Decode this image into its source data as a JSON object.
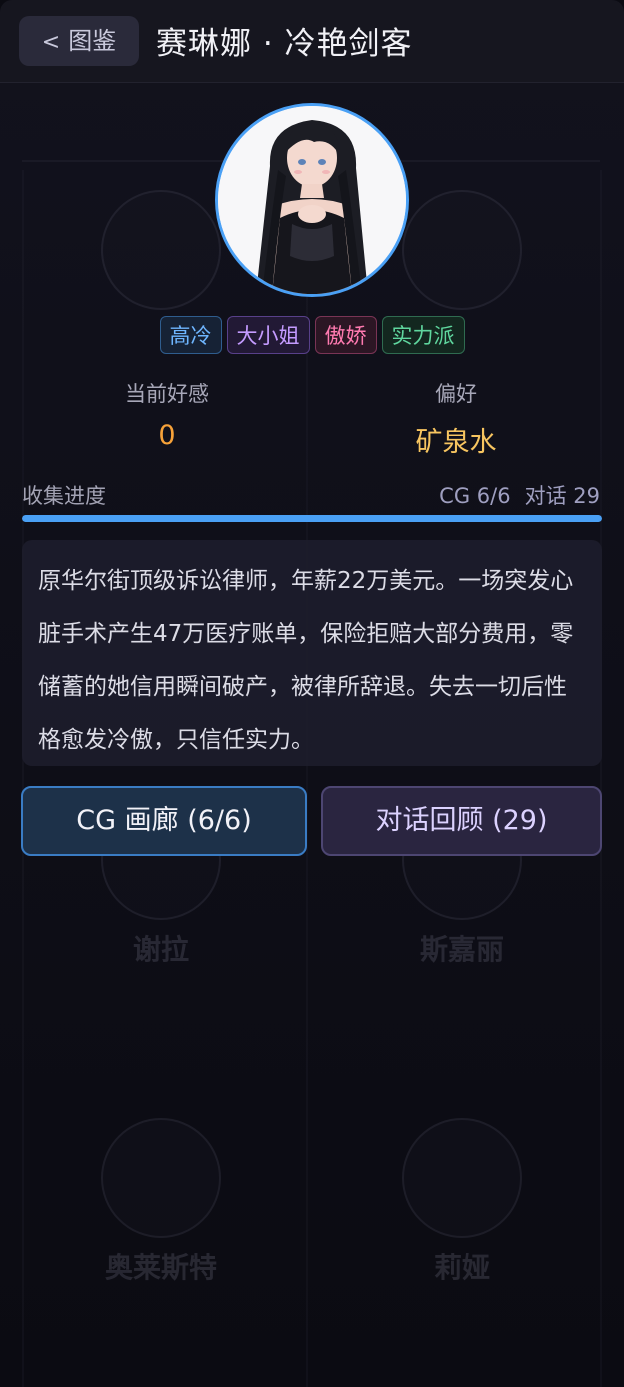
{
  "header": {
    "back_label": "图鉴",
    "back_chevron": "<",
    "title": "赛琳娜 · 冷艳剑客"
  },
  "profile": {
    "avatar_icon": "character-portrait",
    "tags": [
      {
        "label": "高冷",
        "color": "#6fb6ff"
      },
      {
        "label": "大小姐",
        "color": "#c49bff"
      },
      {
        "label": "傲娇",
        "color": "#ff7ab0"
      },
      {
        "label": "实力派",
        "color": "#5fd69e"
      }
    ]
  },
  "stats": {
    "affection_label": "当前好感",
    "affection_value": "0",
    "preference_label": "偏好",
    "preference_value": "矿泉水"
  },
  "progress": {
    "label": "收集进度",
    "cg_text": "CG 6/6",
    "dialog_text": "对话 29",
    "fraction": 1.0,
    "bar_color": "#4aa0f5"
  },
  "description": {
    "text": "原华尔街顶级诉讼律师，年薪22万美元。一场突发心脏手术产生47万医疗账单，保险拒赔大部分费用，零储蓄的她信用瞬间破产，被律所辞退。失去一切后性格愈发冷傲，只信任实力。"
  },
  "actions": {
    "cg_button": "CG 画廊 (6/6)",
    "dialog_button": "对话回顾 (29)"
  },
  "background": {
    "cards": [
      {
        "name": "谢拉",
        "sub": ""
      },
      {
        "name": "斯嘉丽",
        "sub": ""
      },
      {
        "name": "奥莱斯特",
        "sub": ""
      },
      {
        "name": "莉娅",
        "sub": ""
      }
    ]
  },
  "colors": {
    "accent": "#4aa0f5",
    "affection": "#f7a239",
    "preference": "#f7c560"
  }
}
